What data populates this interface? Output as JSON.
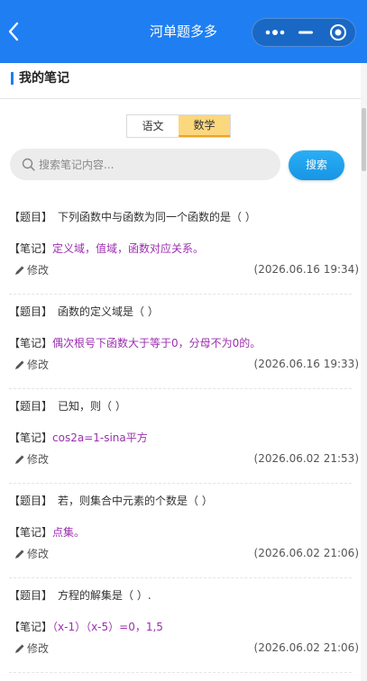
{
  "nav": {
    "title": "河单题多多"
  },
  "page": {
    "title": "我的笔记"
  },
  "tabs": [
    {
      "label": "语文"
    },
    {
      "label": "数学"
    }
  ],
  "search": {
    "placeholder": "搜索笔记内容...",
    "button": "搜索"
  },
  "labels": {
    "question_tag": "【题目】",
    "note_tag": "【笔记】",
    "edit": "修改"
  },
  "notes": [
    {
      "question": "下列函数中与函数为同一个函数的是（   ）",
      "note": "定义域，值域，函数对应关系。",
      "date": "(2026.06.16 19:34)"
    },
    {
      "question": "函数的定义域是（   ）",
      "note": "偶次根号下函数大于等于0，分母不为0的。",
      "date": "(2026.06.16 19:33)"
    },
    {
      "question": "已知，则（   ）",
      "note": "cos2a=1-sina平方",
      "date": "(2026.06.02 21:53)"
    },
    {
      "question": "若，则集合中元素的个数是（   ）",
      "note": "点集。",
      "date": "(2026.06.02 21:06)"
    },
    {
      "question": "方程的解集是（   ）.",
      "note": "（x-1）（x-5）=0，1,5",
      "date": "(2026.06.02 21:06)"
    }
  ],
  "colors": {
    "nav": "#1f7ff2",
    "tab_active": "#fbd77e",
    "note_text": "#9b2fae",
    "search_button": "#1795e4"
  }
}
